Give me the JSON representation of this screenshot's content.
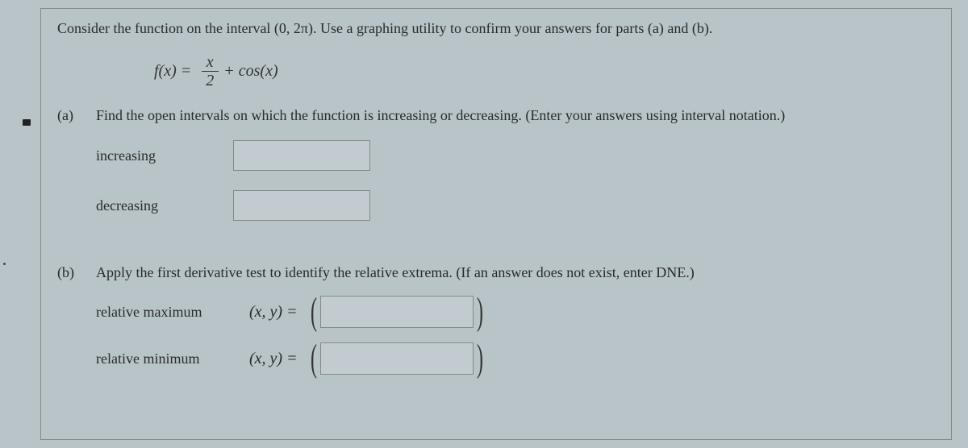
{
  "intro": "Consider the function on the interval (0, 2π). Use a graphing utility to confirm your answers for parts (a) and (b).",
  "formula": {
    "lhs": "f(x) =",
    "num": "x",
    "den": "2",
    "rest": "+ cos(x)"
  },
  "partA": {
    "label": "(a)",
    "prompt": "Find the open intervals on which the function is increasing or decreasing. (Enter your answers using interval notation.)",
    "increasing": "increasing",
    "decreasing": "decreasing"
  },
  "partB": {
    "label": "(b)",
    "prompt": "Apply the first derivative test to identify the relative extrema. (If an answer does not exist, enter DNE.)",
    "relmax": "relative maximum",
    "relmin": "relative minimum",
    "xy": "(x, y)  ="
  }
}
